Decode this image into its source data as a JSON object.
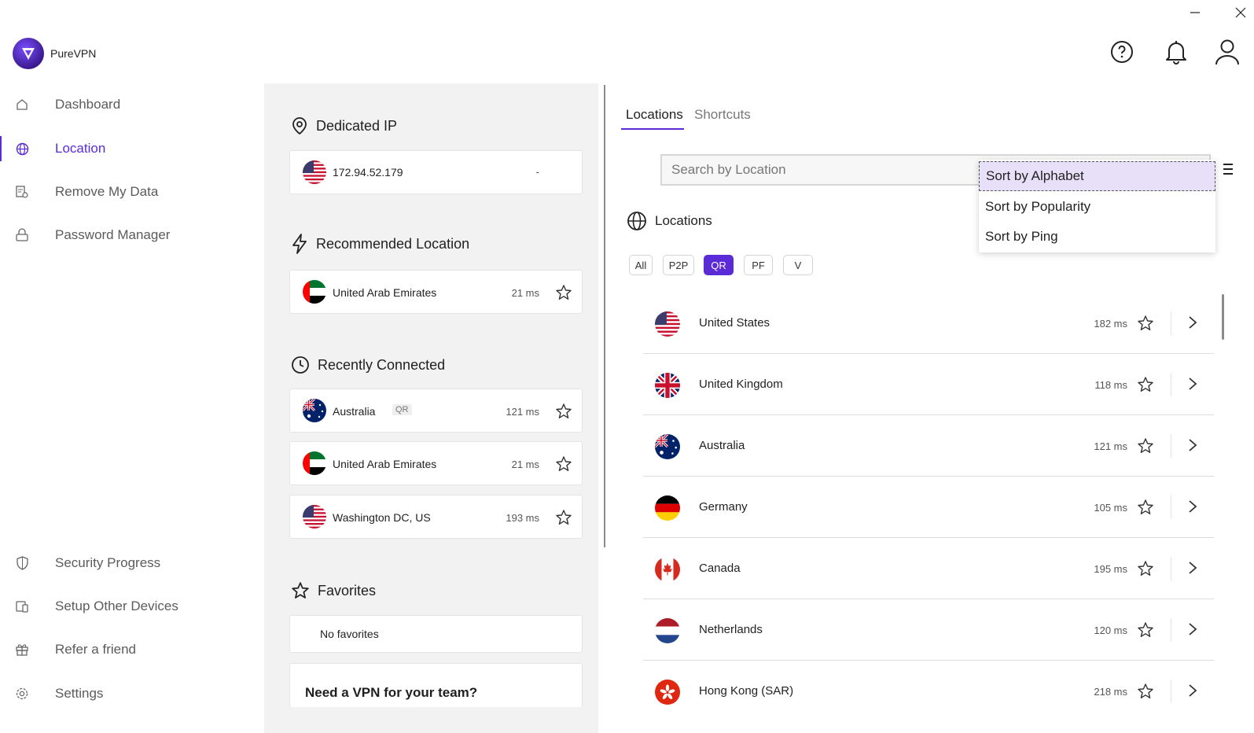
{
  "app": {
    "name": "PureVPN"
  },
  "window": {
    "minimize_label": "—",
    "close_label": "✕"
  },
  "header_icons": [
    "help-icon",
    "bell-icon",
    "user-icon"
  ],
  "colors": {
    "accent": "#5a2bd6",
    "panel_bg": "#f2f2f2"
  },
  "sidebar": {
    "top_items": [
      {
        "label": "Dashboard",
        "icon": "home-icon"
      },
      {
        "label": "Location",
        "icon": "globe-icon",
        "active": true
      },
      {
        "label": "Remove My Data",
        "icon": "data-removal-icon"
      },
      {
        "label": "Password Manager",
        "icon": "lock-icon"
      }
    ],
    "bottom_items": [
      {
        "label": "Security Progress",
        "icon": "shield-icon"
      },
      {
        "label": "Setup Other Devices",
        "icon": "devices-icon"
      },
      {
        "label": "Refer a friend",
        "icon": "gift-icon"
      },
      {
        "label": "Settings",
        "icon": "gear-icon"
      }
    ]
  },
  "middle": {
    "dedicated_ip": {
      "title": "Dedicated IP",
      "ip": "172.94.52.179",
      "value": "-"
    },
    "recommended": {
      "title": "Recommended Location",
      "name": "United Arab Emirates",
      "ping": "21 ms"
    },
    "recently_connected": {
      "title": "Recently Connected",
      "items": [
        {
          "name": "Australia",
          "tag": "QR",
          "ping": "121 ms"
        },
        {
          "name": "United Arab Emirates",
          "ping": "21 ms"
        },
        {
          "name": "Washington DC, US",
          "ping": "193 ms"
        }
      ]
    },
    "favorites": {
      "title": "Favorites",
      "empty_text": "No favorites"
    },
    "team_promo": "Need a VPN for your team?"
  },
  "right": {
    "tabs": [
      "Locations",
      "Shortcuts"
    ],
    "active_tab": "Locations",
    "search_placeholder": "Search by Location",
    "sort_menu": [
      "Sort by Alphabet",
      "Sort by Popularity",
      "Sort by Ping"
    ],
    "sort_selected": "Sort by Alphabet",
    "locations_title": "Locations",
    "filters": [
      "All",
      "P2P",
      "QR",
      "PF",
      "V"
    ],
    "active_filter": "QR",
    "countries": [
      {
        "name": "United States",
        "ping": "182 ms",
        "flag": "us"
      },
      {
        "name": "United Kingdom",
        "ping": "118 ms",
        "flag": "uk"
      },
      {
        "name": "Australia",
        "ping": "121 ms",
        "flag": "au"
      },
      {
        "name": "Germany",
        "ping": "105 ms",
        "flag": "de"
      },
      {
        "name": "Canada",
        "ping": "195 ms",
        "flag": "ca"
      },
      {
        "name": "Netherlands",
        "ping": "120 ms",
        "flag": "nl"
      },
      {
        "name": "Hong Kong (SAR)",
        "ping": "218 ms",
        "flag": "hk"
      }
    ]
  }
}
